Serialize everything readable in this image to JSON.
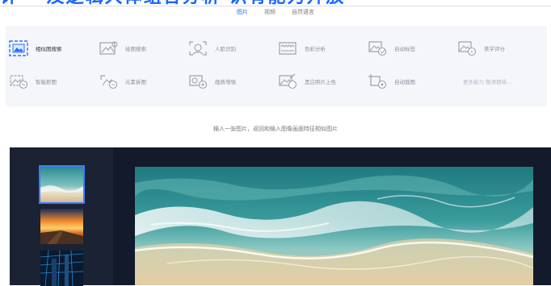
{
  "banner": {
    "text": "计一 及逻辑大体组合分析 识有能力开放"
  },
  "tabs": [
    {
      "label": "图片",
      "active": true
    },
    {
      "label": "视频",
      "active": false
    },
    {
      "label": "自然语言",
      "active": false
    }
  ],
  "functions": {
    "row1": [
      {
        "label": "相似图搜索",
        "icon": "similar-image-search-icon"
      },
      {
        "label": "绘图搜索",
        "icon": "sketch-search-icon"
      },
      {
        "label": "人脸识别",
        "icon": "face-recognition-icon"
      },
      {
        "label": "色彩分析",
        "icon": "color-analysis-icon"
      },
      {
        "label": "自动标签",
        "icon": "auto-tag-icon"
      },
      {
        "label": "美学评分",
        "icon": "aesthetic-score-icon"
      }
    ],
    "row2": [
      {
        "label": "智能抠图",
        "icon": "smart-cutout-icon"
      },
      {
        "label": "元素拆图",
        "icon": "element-split-icon"
      },
      {
        "label": "画质增强",
        "icon": "quality-enhance-icon"
      },
      {
        "label": "黑白照片上色",
        "icon": "colorize-icon"
      },
      {
        "label": "自动裁图",
        "icon": "auto-crop-icon"
      },
      {
        "label": "更多能力 敬请期待...",
        "icon": ""
      }
    ]
  },
  "subtitle": "输入一张图片，返回和输入图像画面特征相似图片",
  "thumbnails": [
    {
      "name": "beach-waves",
      "selected": true
    },
    {
      "name": "pier-sunset",
      "selected": false
    },
    {
      "name": "city-night",
      "selected": false
    }
  ],
  "colors": {
    "accent": "#2f6bff",
    "viewer_bg": "#131a2b",
    "panel_bg": "#f4f6fa"
  }
}
